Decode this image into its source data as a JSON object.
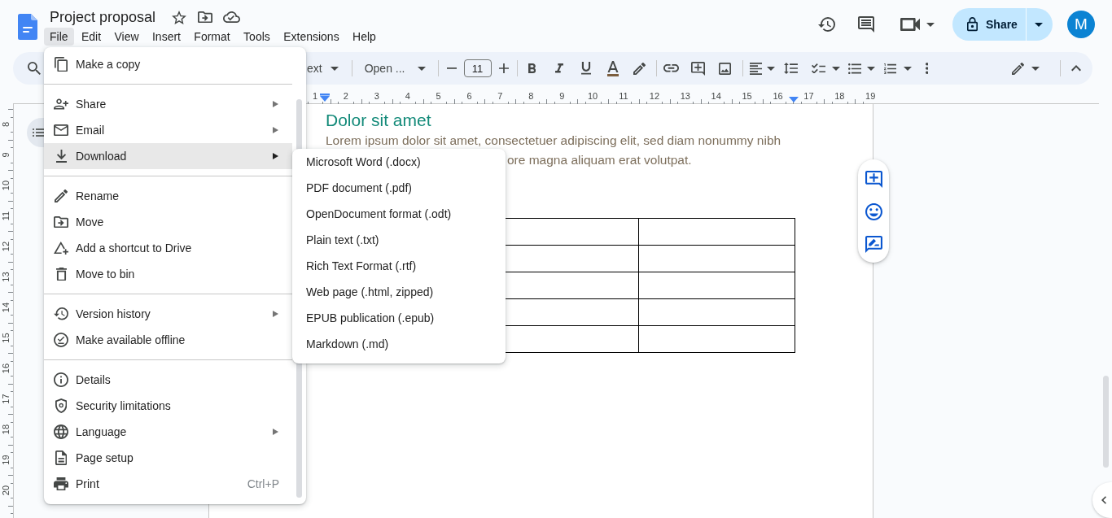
{
  "header": {
    "title": "Project proposal",
    "menu_bar": [
      {
        "label": "File",
        "selected": true
      },
      {
        "label": "Edit",
        "selected": false
      },
      {
        "label": "View",
        "selected": false
      },
      {
        "label": "Insert",
        "selected": false
      },
      {
        "label": "Format",
        "selected": false
      },
      {
        "label": "Tools",
        "selected": false
      },
      {
        "label": "Extensions",
        "selected": false
      },
      {
        "label": "Help",
        "selected": false
      }
    ],
    "share_button": "Share",
    "avatar_initial": "M"
  },
  "toolbar": {
    "style_dropdown": "ext",
    "font_dropdown": "Open ...",
    "font_size": "11"
  },
  "rulers": {
    "horizontal": [
      "1",
      "2",
      "3",
      "4",
      "5",
      "6",
      "7",
      "8",
      "9",
      "10",
      "11",
      "12",
      "13",
      "14",
      "15",
      "16",
      "17",
      "18",
      "19"
    ],
    "vertical": [
      "8",
      "9",
      "10",
      "11",
      "12",
      "13",
      "14",
      "15",
      "16",
      "17",
      "18",
      "19",
      "20"
    ]
  },
  "document": {
    "heading": "Dolor sit amet",
    "paragraph_lines": [
      "Lorem ipsum dolor sit amet, consectetuer adipiscing elit, sed diam nonummy nibh",
      "ore magna aliquam erat volutpat."
    ]
  },
  "file_menu": {
    "groups": [
      [
        {
          "label": "Make a copy",
          "submenu": false,
          "selected": false
        }
      ],
      [
        {
          "label": "Share",
          "submenu": true,
          "selected": false
        },
        {
          "label": "Email",
          "submenu": true,
          "selected": false
        },
        {
          "label": "Download",
          "submenu": true,
          "selected": true
        }
      ],
      [
        {
          "label": "Rename",
          "submenu": false,
          "selected": false
        },
        {
          "label": "Move",
          "submenu": false,
          "selected": false
        },
        {
          "label": "Add a shortcut to Drive",
          "submenu": false,
          "selected": false
        },
        {
          "label": "Move to bin",
          "submenu": false,
          "selected": false
        }
      ],
      [
        {
          "label": "Version history",
          "submenu": true,
          "selected": false
        },
        {
          "label": "Make available offline",
          "submenu": false,
          "selected": false
        }
      ],
      [
        {
          "label": "Details",
          "submenu": false,
          "selected": false
        },
        {
          "label": "Security limitations",
          "submenu": false,
          "selected": false
        },
        {
          "label": "Language",
          "submenu": true,
          "selected": false
        },
        {
          "label": "Page setup",
          "submenu": false,
          "selected": false
        },
        {
          "label": "Print",
          "submenu": false,
          "selected": false,
          "shortcut": "Ctrl+P"
        }
      ]
    ]
  },
  "download_submenu": {
    "items": [
      {
        "label": "Microsoft Word (.docx)",
        "selected": false
      },
      {
        "label": "PDF document (.pdf)",
        "selected": false
      },
      {
        "label": "OpenDocument format (.odt)",
        "selected": false
      },
      {
        "label": "Plain text (.txt)",
        "selected": false
      },
      {
        "label": "Rich Text Format (.rtf)",
        "selected": false
      },
      {
        "label": "Web page (.html, zipped)",
        "selected": false
      },
      {
        "label": "EPUB publication (.epub)",
        "selected": false
      },
      {
        "label": "Markdown (.md)",
        "selected": false
      }
    ]
  }
}
